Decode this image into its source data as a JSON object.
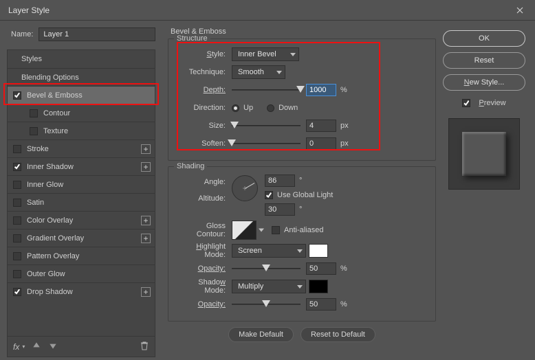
{
  "window": {
    "title": "Layer Style"
  },
  "name": {
    "label": "Name:",
    "value": "Layer 1"
  },
  "styles": {
    "header": "Styles",
    "blending": "Blending Options",
    "bevel": "Bevel & Emboss",
    "contour": "Contour",
    "texture": "Texture",
    "stroke": "Stroke",
    "inner_shadow": "Inner Shadow",
    "inner_glow": "Inner Glow",
    "satin": "Satin",
    "color_overlay": "Color Overlay",
    "gradient_overlay": "Gradient Overlay",
    "pattern_overlay": "Pattern Overlay",
    "outer_glow": "Outer Glow",
    "drop_shadow": "Drop Shadow"
  },
  "panel": {
    "title": "Bevel & Emboss",
    "structure": {
      "legend": "Structure",
      "style_label": "Style:",
      "style_value": "Inner Bevel",
      "technique_label": "Technique:",
      "technique_value": "Smooth",
      "depth_label": "Depth:",
      "depth_value": "1000",
      "depth_unit": "%",
      "direction_label": "Direction:",
      "direction_up": "Up",
      "direction_down": "Down",
      "size_label": "Size:",
      "size_value": "4",
      "size_unit": "px",
      "soften_label": "Soften:",
      "soften_value": "0",
      "soften_unit": "px"
    },
    "shading": {
      "legend": "Shading",
      "angle_label": "Angle:",
      "angle_value": "86",
      "angle_unit": "°",
      "global_light": "Use Global Light",
      "altitude_label": "Altitude:",
      "altitude_value": "30",
      "altitude_unit": "°",
      "gloss_label": "Gloss Contour:",
      "antialiased": "Anti-aliased",
      "highlight_mode_label": "Highlight Mode:",
      "highlight_mode_value": "Screen",
      "highlight_color": "#ffffff",
      "highlight_opacity_label": "Opacity:",
      "highlight_opacity_value": "50",
      "opacity_unit": "%",
      "shadow_mode_label": "Shadow Mode:",
      "shadow_mode_value": "Multiply",
      "shadow_color": "#000000",
      "shadow_opacity_label": "Opacity:",
      "shadow_opacity_value": "50"
    },
    "make_default": "Make Default",
    "reset_default": "Reset to Default"
  },
  "right": {
    "ok": "OK",
    "reset": "Reset",
    "new_style": "New Style...",
    "preview": "Preview"
  },
  "footer": {
    "fx": "fx"
  }
}
